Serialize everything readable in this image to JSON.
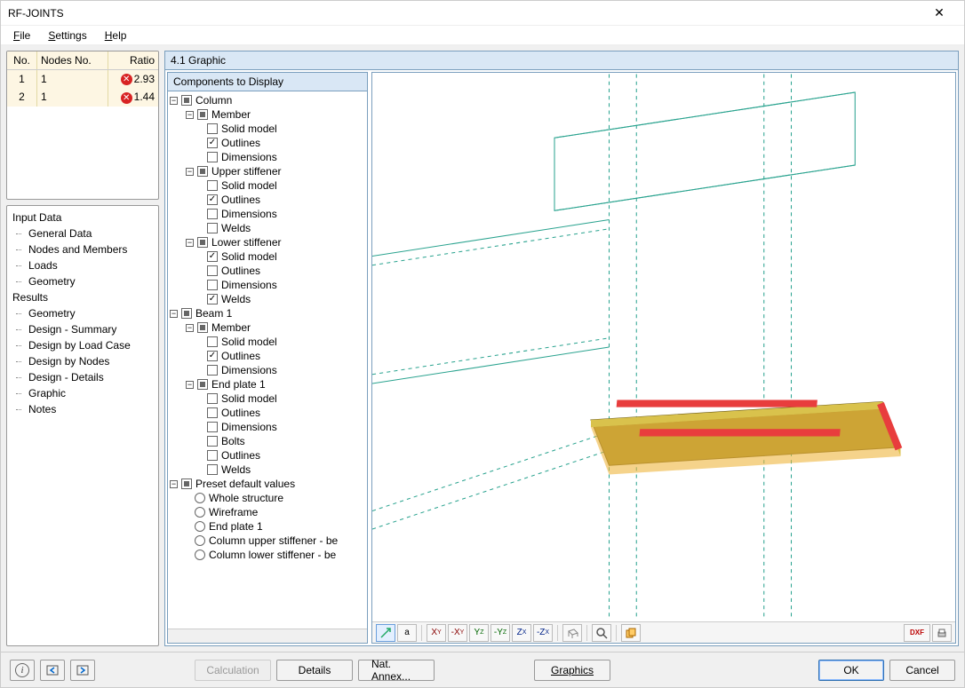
{
  "window": {
    "title": "RF-JOINTS"
  },
  "menu": {
    "file": "File",
    "settings": "Settings",
    "help": "Help"
  },
  "ratio_table": {
    "headers": {
      "no": "No.",
      "nodes": "Nodes No.",
      "ratio": "Ratio"
    },
    "rows": [
      {
        "no": "1",
        "nodes": "1",
        "ratio": "2.93"
      },
      {
        "no": "2",
        "nodes": "1",
        "ratio": "1.44"
      }
    ]
  },
  "nav": {
    "input_group": "Input Data",
    "input_items": [
      "General Data",
      "Nodes and Members",
      "Loads",
      "Geometry"
    ],
    "results_group": "Results",
    "results_items": [
      "Geometry",
      "Design - Summary",
      "Design by Load Case",
      "Design by Nodes",
      "Design - Details",
      "Graphic",
      "Notes"
    ]
  },
  "right": {
    "header": "4.1 Graphic",
    "components_header": "Components to Display"
  },
  "tree": {
    "column": "Column",
    "member": "Member",
    "solid_model": "Solid model",
    "outlines": "Outlines",
    "dimensions": "Dimensions",
    "upper_stiffener": "Upper stiffener",
    "welds": "Welds",
    "lower_stiffener": "Lower stiffener",
    "beam1": "Beam 1",
    "end_plate1": "End plate 1",
    "bolts": "Bolts",
    "preset": "Preset default values",
    "whole_structure": "Whole structure",
    "wireframe": "Wireframe",
    "end_plate1_r": "End plate 1",
    "col_upper_stiff": "Column upper stiffener - be",
    "col_lower_stiff": "Column lower stiffener - be"
  },
  "toolbar": {
    "iso": "↘",
    "top": "a",
    "xy": "XY",
    "xy2": "-XY",
    "yz": "YZ",
    "yz2": "-YZ",
    "xz": "XZ",
    "xz2": "-XZ",
    "box": "▭",
    "lens": "🔍",
    "copy": "📋",
    "dxf": "DXF",
    "print": "🖨"
  },
  "bottom": {
    "calculation": "Calculation",
    "details": "Details",
    "nat_annex": "Nat. Annex...",
    "graphics": "Graphics",
    "ok": "OK",
    "cancel": "Cancel"
  }
}
